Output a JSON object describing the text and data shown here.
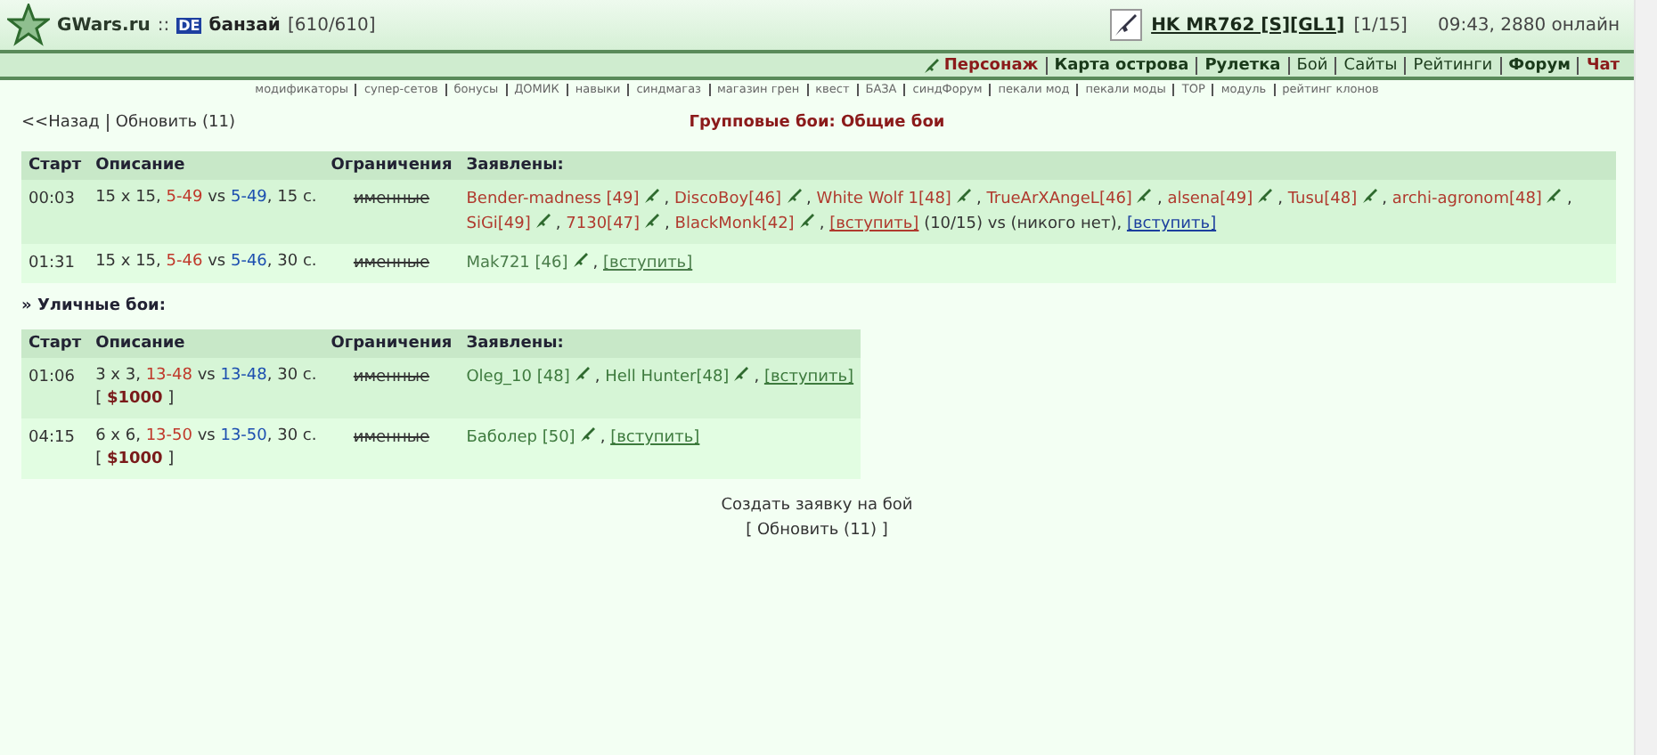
{
  "header": {
    "site": "GWars.ru",
    "separator": "::",
    "badge": "DE",
    "user": "банзай",
    "hp": "[610/610]",
    "weapon": "HK MR762 [S][GL1]",
    "ammo": "[1/15]",
    "status": "09:43, 2880 онлайн"
  },
  "nav": [
    {
      "label": "Персонаж",
      "kind": "accent",
      "icon": true
    },
    {
      "label": "Карта острова",
      "kind": "bold"
    },
    {
      "label": "Рулетка",
      "kind": "bold"
    },
    {
      "label": "Бой",
      "kind": "plain"
    },
    {
      "label": "Сайты",
      "kind": "plain"
    },
    {
      "label": "Рейтинги",
      "kind": "plain"
    },
    {
      "label": "Форум",
      "kind": "bold"
    },
    {
      "label": "Чат",
      "kind": "accent"
    }
  ],
  "subnav": [
    "модификаторы",
    "супер-сетов",
    "бонусы",
    "ДОМИК",
    "навыки",
    "синдмагаз",
    "магазин грен",
    "квест",
    "БАЗА",
    "синдФорум",
    "пекали мод",
    "пекали моды",
    "TOP",
    "модуль",
    "рейтинг клонов"
  ],
  "back": "<<Назад",
  "refresh": "Обновить (11)",
  "title": "Групповые бои: Общие бои",
  "group_table": {
    "columns": [
      "Старт",
      "Описание",
      "Ограничения",
      "Заявлены:"
    ],
    "rows": [
      {
        "start": "00:03",
        "size": "15 x 15,",
        "range_a": "5-49",
        "vs": "vs",
        "range_b": "5-49",
        "duration": ", 15 с.",
        "restriction": "именные",
        "entries": [
          {
            "kind": "player",
            "name": "Bender-madness [49]",
            "color": "#b03a2e",
            "after": ","
          },
          {
            "kind": "player",
            "name": "DiscoBoy[46]",
            "color": "#b03a2e",
            "after": ","
          },
          {
            "kind": "player",
            "name": "White Wolf 1[48]",
            "color": "#b03a2e",
            "after": ","
          },
          {
            "kind": "player",
            "name": "TrueArXAngeL[46]",
            "color": "#b03a2e",
            "after": ","
          },
          {
            "kind": "player",
            "name": "alsena[49]",
            "color": "#b03a2e",
            "after": ","
          },
          {
            "kind": "player",
            "name": "Tusu[48]",
            "color": "#b03a2e",
            "after": ","
          },
          {
            "kind": "player",
            "name": "archi-agronom[48]",
            "color": "#b03a2e",
            "after": ","
          },
          {
            "kind": "player",
            "name": "SiGi[49]",
            "color": "#b03a2e",
            "after": ","
          },
          {
            "kind": "player",
            "name": "7130[47]",
            "color": "#b03a2e",
            "after": ","
          },
          {
            "kind": "player",
            "name": "BlackMonk[42]",
            "color": "#b03a2e",
            "after": ","
          },
          {
            "kind": "join",
            "label": "[вступить]",
            "color": "#b03a2e"
          },
          {
            "kind": "text",
            "label": "(10/15) vs (никого нет),"
          },
          {
            "kind": "join",
            "label": "[вступить]",
            "color": "#1c3f9e"
          }
        ]
      },
      {
        "start": "01:31",
        "size": "15 x 15,",
        "range_a": "5-46",
        "vs": "vs",
        "range_b": "5-46",
        "duration": ", 30 с.",
        "restriction": "именные",
        "entries": [
          {
            "kind": "player",
            "name": "Mak721 [46]",
            "color": "#4a7d4a",
            "after": ","
          },
          {
            "kind": "join",
            "label": "[вступить]",
            "color": "#4a7d4a"
          }
        ]
      }
    ]
  },
  "street_heading": "» Уличные бои:",
  "street_table": {
    "columns": [
      "Старт",
      "Описание",
      "Ограничения",
      "Заявлены:"
    ],
    "rows": [
      {
        "start": "01:06",
        "size": "3 x 3,",
        "range_a": "13-48",
        "vs": "vs",
        "range_b": "13-48",
        "duration": ", 30 с.",
        "stake": "[ **$1000** ]",
        "restriction": "именные",
        "entries": [
          {
            "kind": "player",
            "name": "Oleg_10 [48]",
            "color": "#3d7a3d",
            "after": ","
          },
          {
            "kind": "player",
            "name": "Hell Hunter[48]",
            "color": "#3d7a3d",
            "after": ","
          },
          {
            "kind": "join",
            "label": "[вступить]",
            "color": "#3d7a3d"
          }
        ]
      },
      {
        "start": "04:15",
        "size": "6 x 6,",
        "range_a": "13-50",
        "vs": "vs",
        "range_b": "13-50",
        "duration": ", 30 с.",
        "stake": "[ **$1000** ]",
        "restriction": "именные",
        "entries": [
          {
            "kind": "player",
            "name": "Баболер [50]",
            "color": "#3d7a3d",
            "after": ","
          },
          {
            "kind": "join",
            "label": "[вступить]",
            "color": "#3d7a3d"
          }
        ]
      }
    ]
  },
  "create": "Создать заявку на бой",
  "bottom_refresh": "[ Обновить (11) ]"
}
